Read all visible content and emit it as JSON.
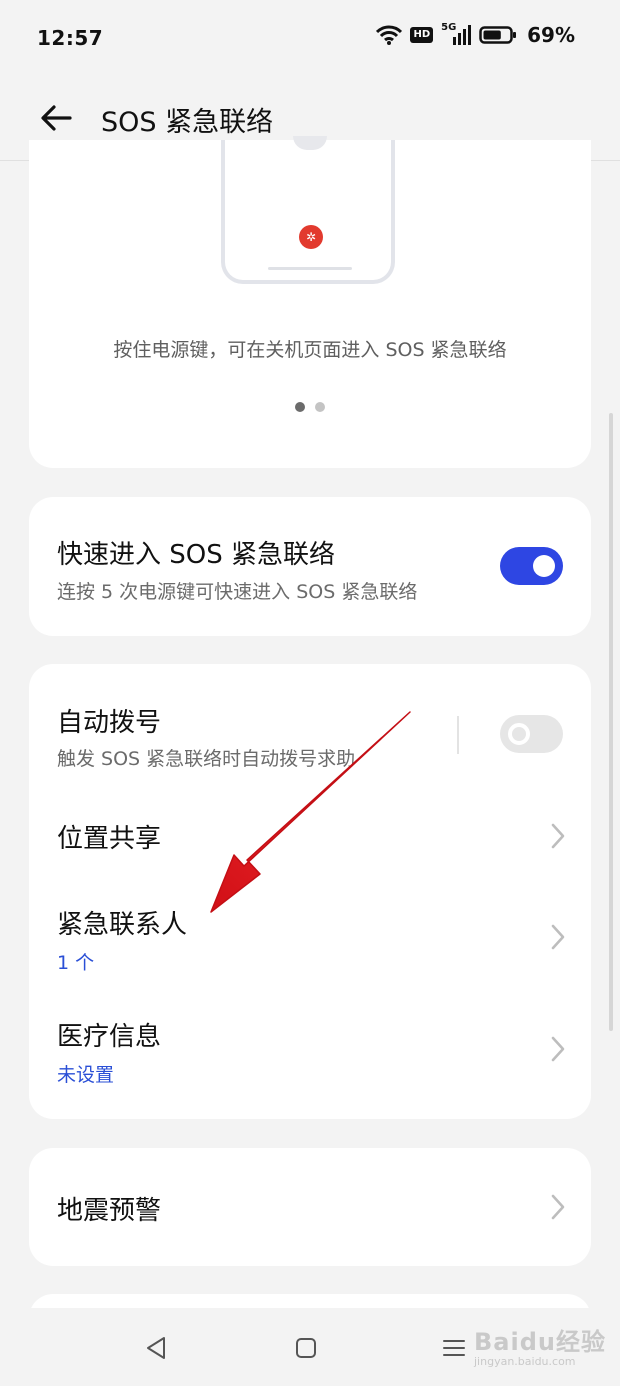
{
  "status_bar": {
    "time": "12:57",
    "net_badge": "HD",
    "signal_label": "5G",
    "battery": "69%",
    "battery_level": 0.69
  },
  "header": {
    "title": "SOS 紧急联络",
    "back_icon": "arrow-left-icon"
  },
  "intro": {
    "caption": "按住电源键，可在关机页面进入 SOS 紧急联络",
    "page_dots": {
      "count": 2,
      "active_index": 0
    }
  },
  "quick_entry": {
    "title": "快速进入 SOS 紧急联络",
    "subtitle": "连按 5 次电源键可快速进入 SOS 紧急联络",
    "enabled": true
  },
  "settings": {
    "auto_dial": {
      "title": "自动拨号",
      "subtitle": "触发 SOS 紧急联络时自动拨号求助",
      "enabled": false
    },
    "location_share": {
      "title": "位置共享"
    },
    "emergency_contacts": {
      "title": "紧急联系人",
      "value": "1 个"
    },
    "medical_info": {
      "title": "医疗信息",
      "value": "未设置"
    }
  },
  "earthquake": {
    "title": "地震预警"
  },
  "nav_bar": {
    "icons": [
      "triangle-back-icon",
      "square-home-icon",
      "menu-recents-icon"
    ]
  },
  "watermark": {
    "logo": "Baidu经验",
    "domain": "jingyan.baidu.com"
  },
  "colors": {
    "accent": "#2e46e3",
    "link_blue": "#2a4fd6",
    "sos_red": "#e23a2e",
    "annotation_arrow": "#e0141b",
    "background": "#f3f3f3",
    "card": "#ffffff"
  }
}
